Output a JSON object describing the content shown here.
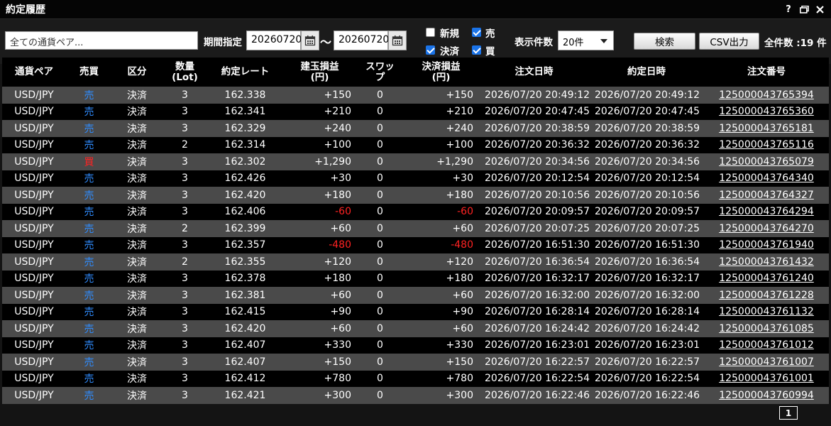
{
  "window": {
    "title": "約定履歴",
    "help": "?"
  },
  "filters": {
    "pair_value": "全ての通貨ペア...",
    "period_label": "期間指定",
    "date_from": "20260720",
    "tilde": "〜",
    "date_to": "20260720",
    "checks": {
      "new": {
        "label": "新規",
        "checked": false
      },
      "sell": {
        "label": "売",
        "checked": true
      },
      "settle": {
        "label": "決済",
        "checked": true
      },
      "buy": {
        "label": "買",
        "checked": true
      }
    },
    "display_count_label": "表示件数",
    "display_count_value": "20件",
    "search_label": "検索",
    "csv_label": "CSV出力",
    "total_label": "全件数 :19 件"
  },
  "table": {
    "headers": {
      "pair": "通貨ペア",
      "side": "売買",
      "kind": "区分",
      "qty_1": "数量",
      "qty_2": "(Lot)",
      "rate": "約定レート",
      "pos_pl_1": "建玉損益",
      "pos_pl_2": "(円)",
      "swap": "スワップ",
      "set_pl_1": "決済損益",
      "set_pl_2": "(円)",
      "order_time": "注文日時",
      "exec_time": "約定日時",
      "order_no": "注文番号"
    },
    "rows": [
      {
        "pair": "USD/JPY",
        "side": "売",
        "kind": "決済",
        "qty": "3",
        "rate": "162.338",
        "pos_pl": "+150",
        "swap": "0",
        "set_pl": "+150",
        "order_time": "2026/07/20 20:49:12",
        "exec_time": "2026/07/20 20:49:12",
        "order_no": "125000043765394"
      },
      {
        "pair": "USD/JPY",
        "side": "売",
        "kind": "決済",
        "qty": "3",
        "rate": "162.341",
        "pos_pl": "+210",
        "swap": "0",
        "set_pl": "+210",
        "order_time": "2026/07/20 20:47:45",
        "exec_time": "2026/07/20 20:47:45",
        "order_no": "125000043765360"
      },
      {
        "pair": "USD/JPY",
        "side": "売",
        "kind": "決済",
        "qty": "3",
        "rate": "162.329",
        "pos_pl": "+240",
        "swap": "0",
        "set_pl": "+240",
        "order_time": "2026/07/20 20:38:59",
        "exec_time": "2026/07/20 20:38:59",
        "order_no": "125000043765181"
      },
      {
        "pair": "USD/JPY",
        "side": "売",
        "kind": "決済",
        "qty": "2",
        "rate": "162.314",
        "pos_pl": "+100",
        "swap": "0",
        "set_pl": "+100",
        "order_time": "2026/07/20 20:36:32",
        "exec_time": "2026/07/20 20:36:32",
        "order_no": "125000043765116"
      },
      {
        "pair": "USD/JPY",
        "side": "買",
        "kind": "決済",
        "qty": "3",
        "rate": "162.302",
        "pos_pl": "+1,290",
        "swap": "0",
        "set_pl": "+1,290",
        "order_time": "2026/07/20 20:34:56",
        "exec_time": "2026/07/20 20:34:56",
        "order_no": "125000043765079"
      },
      {
        "pair": "USD/JPY",
        "side": "売",
        "kind": "決済",
        "qty": "3",
        "rate": "162.426",
        "pos_pl": "+30",
        "swap": "0",
        "set_pl": "+30",
        "order_time": "2026/07/20 20:12:54",
        "exec_time": "2026/07/20 20:12:54",
        "order_no": "125000043764340"
      },
      {
        "pair": "USD/JPY",
        "side": "売",
        "kind": "決済",
        "qty": "3",
        "rate": "162.420",
        "pos_pl": "+180",
        "swap": "0",
        "set_pl": "+180",
        "order_time": "2026/07/20 20:10:56",
        "exec_time": "2026/07/20 20:10:56",
        "order_no": "125000043764327"
      },
      {
        "pair": "USD/JPY",
        "side": "売",
        "kind": "決済",
        "qty": "3",
        "rate": "162.406",
        "pos_pl": "-60",
        "swap": "0",
        "set_pl": "-60",
        "order_time": "2026/07/20 20:09:57",
        "exec_time": "2026/07/20 20:09:57",
        "order_no": "125000043764294"
      },
      {
        "pair": "USD/JPY",
        "side": "売",
        "kind": "決済",
        "qty": "2",
        "rate": "162.399",
        "pos_pl": "+60",
        "swap": "0",
        "set_pl": "+60",
        "order_time": "2026/07/20 20:07:25",
        "exec_time": "2026/07/20 20:07:25",
        "order_no": "125000043764270"
      },
      {
        "pair": "USD/JPY",
        "side": "売",
        "kind": "決済",
        "qty": "3",
        "rate": "162.357",
        "pos_pl": "-480",
        "swap": "0",
        "set_pl": "-480",
        "order_time": "2026/07/20 16:51:30",
        "exec_time": "2026/07/20 16:51:30",
        "order_no": "125000043761940"
      },
      {
        "pair": "USD/JPY",
        "side": "売",
        "kind": "決済",
        "qty": "2",
        "rate": "162.355",
        "pos_pl": "+120",
        "swap": "0",
        "set_pl": "+120",
        "order_time": "2026/07/20 16:36:54",
        "exec_time": "2026/07/20 16:36:54",
        "order_no": "125000043761432"
      },
      {
        "pair": "USD/JPY",
        "side": "売",
        "kind": "決済",
        "qty": "3",
        "rate": "162.378",
        "pos_pl": "+180",
        "swap": "0",
        "set_pl": "+180",
        "order_time": "2026/07/20 16:32:17",
        "exec_time": "2026/07/20 16:32:17",
        "order_no": "125000043761240"
      },
      {
        "pair": "USD/JPY",
        "side": "売",
        "kind": "決済",
        "qty": "3",
        "rate": "162.381",
        "pos_pl": "+60",
        "swap": "0",
        "set_pl": "+60",
        "order_time": "2026/07/20 16:32:00",
        "exec_time": "2026/07/20 16:32:00",
        "order_no": "125000043761228"
      },
      {
        "pair": "USD/JPY",
        "side": "売",
        "kind": "決済",
        "qty": "3",
        "rate": "162.415",
        "pos_pl": "+90",
        "swap": "0",
        "set_pl": "+90",
        "order_time": "2026/07/20 16:28:14",
        "exec_time": "2026/07/20 16:28:14",
        "order_no": "125000043761132"
      },
      {
        "pair": "USD/JPY",
        "side": "売",
        "kind": "決済",
        "qty": "3",
        "rate": "162.420",
        "pos_pl": "+60",
        "swap": "0",
        "set_pl": "+60",
        "order_time": "2026/07/20 16:24:42",
        "exec_time": "2026/07/20 16:24:42",
        "order_no": "125000043761085"
      },
      {
        "pair": "USD/JPY",
        "side": "売",
        "kind": "決済",
        "qty": "3",
        "rate": "162.407",
        "pos_pl": "+330",
        "swap": "0",
        "set_pl": "+330",
        "order_time": "2026/07/20 16:23:01",
        "exec_time": "2026/07/20 16:23:01",
        "order_no": "125000043761012"
      },
      {
        "pair": "USD/JPY",
        "side": "売",
        "kind": "決済",
        "qty": "3",
        "rate": "162.407",
        "pos_pl": "+150",
        "swap": "0",
        "set_pl": "+150",
        "order_time": "2026/07/20 16:22:57",
        "exec_time": "2026/07/20 16:22:57",
        "order_no": "125000043761007"
      },
      {
        "pair": "USD/JPY",
        "side": "売",
        "kind": "決済",
        "qty": "3",
        "rate": "162.412",
        "pos_pl": "+780",
        "swap": "0",
        "set_pl": "+780",
        "order_time": "2026/07/20 16:22:54",
        "exec_time": "2026/07/20 16:22:54",
        "order_no": "125000043761001"
      },
      {
        "pair": "USD/JPY",
        "side": "売",
        "kind": "決済",
        "qty": "3",
        "rate": "162.421",
        "pos_pl": "+300",
        "swap": "0",
        "set_pl": "+300",
        "order_time": "2026/07/20 16:22:46",
        "exec_time": "2026/07/20 16:22:46",
        "order_no": "125000043760994"
      }
    ]
  },
  "pagination": {
    "current": "1"
  },
  "colors": {
    "sell": "#2f8cff",
    "buy": "#ff2222",
    "negative": "#ff2222",
    "checkbox": "#1a73e8"
  },
  "icons": {
    "help": "question-icon",
    "restore": "restore-window-icon",
    "close": "close-icon",
    "calendar": "calendar-icon"
  }
}
